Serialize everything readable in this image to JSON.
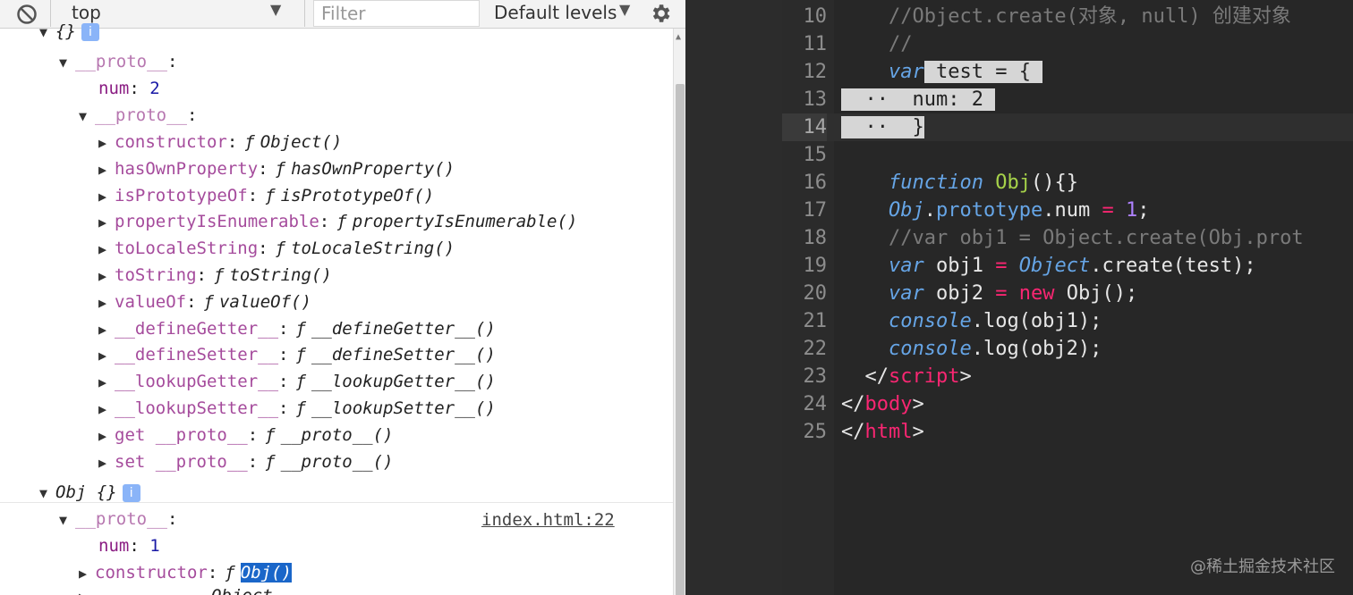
{
  "toolbar": {
    "context": "top",
    "filter_placeholder": "Filter",
    "levels": "Default levels"
  },
  "console": {
    "top_partial": "{}",
    "proto1_key": "__proto__",
    "num1_key": "num",
    "num1_val": "2",
    "proto2_key": "__proto__",
    "members": [
      {
        "key": "constructor",
        "fn": "Object()"
      },
      {
        "key": "hasOwnProperty",
        "fn": "hasOwnProperty()"
      },
      {
        "key": "isPrototypeOf",
        "fn": "isPrototypeOf()"
      },
      {
        "key": "propertyIsEnumerable",
        "fn": "propertyIsEnumerable()"
      },
      {
        "key": "toLocaleString",
        "fn": "toLocaleString()"
      },
      {
        "key": "toString",
        "fn": "toString()"
      },
      {
        "key": "valueOf",
        "fn": "valueOf()"
      },
      {
        "key": "__defineGetter__",
        "fn": "__defineGetter__()"
      },
      {
        "key": "__defineSetter__",
        "fn": "__defineSetter__()"
      },
      {
        "key": "__lookupGetter__",
        "fn": "__lookupGetter__()"
      },
      {
        "key": "__lookupSetter__",
        "fn": "__lookupSetter__()"
      },
      {
        "key": "get __proto__",
        "fn": "__proto__()"
      },
      {
        "key": "set __proto__",
        "fn": "__proto__()"
      }
    ],
    "fn_symbol": "ƒ",
    "obj_label": "Obj {}",
    "source_link": "index.html:22",
    "obj_proto_key": "__proto__",
    "obj_num_key": "num",
    "obj_num_val": "1",
    "obj_ctor_key": "constructor",
    "obj_ctor_fn": "Obj()",
    "bottom_partial": "Object"
  },
  "editor": {
    "lines": [
      {
        "n": "10",
        "text": "//Object.create(对象, null) 创建对象"
      },
      {
        "n": "11",
        "text": "//"
      },
      {
        "n": "12",
        "kw": "var",
        "text": "test = {"
      },
      {
        "n": "13",
        "text": "num: 2"
      },
      {
        "n": "14",
        "text": "}"
      },
      {
        "n": "15",
        "text": ""
      },
      {
        "n": "16",
        "kw": "function",
        "fn": "Obj",
        "text": "(){}"
      },
      {
        "n": "17",
        "obj": "Obj",
        "prop": "prototype",
        "text": "num",
        "op": "=",
        "val": "1"
      },
      {
        "n": "18",
        "text": "//var obj1 = Object.create(Obj.prot"
      },
      {
        "n": "19",
        "kw": "var",
        "text": "obj1",
        "op": "=",
        "obj": "Object",
        "rest": ".create(test);"
      },
      {
        "n": "20",
        "kw": "var",
        "text": "obj2",
        "op": "=",
        "kw2": "new",
        "rest": "Obj();"
      },
      {
        "n": "21",
        "obj": "console",
        "rest": ".log(obj1);"
      },
      {
        "n": "22",
        "obj": "console",
        "rest": ".log(obj2);"
      },
      {
        "n": "23",
        "tag": "script"
      },
      {
        "n": "24",
        "tag": "body"
      },
      {
        "n": "25",
        "tag": "html"
      }
    ]
  },
  "watermark": "@稀土掘金技术社区"
}
